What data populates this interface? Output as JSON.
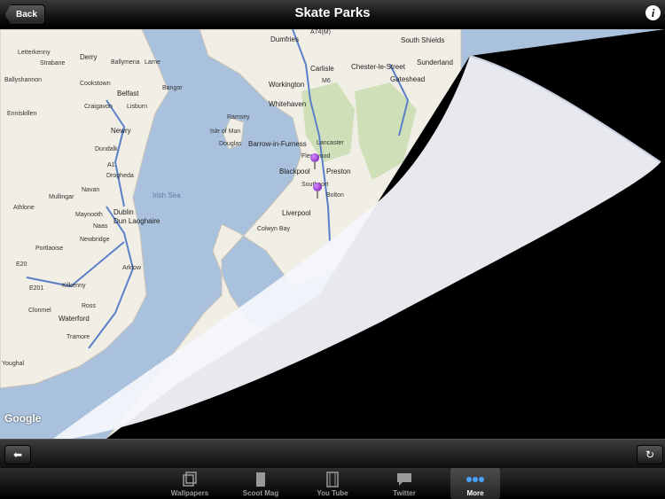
{
  "nav": {
    "title": "Skate Parks",
    "back_label": "Back"
  },
  "map": {
    "logo": "Google",
    "labels": {
      "dumfries": "Dumfries",
      "south_shields": "South Shields",
      "gateshead": "Gateshead",
      "sunderland": "Sunderland",
      "carlisle": "Carlisle",
      "chester": "Chester-le-Street",
      "letterkenny": "Letterkenny",
      "derry": "Derry",
      "strabane": "Strabane",
      "ballymena": "Ballymena",
      "larne": "Larne",
      "belfast": "Belfast",
      "bangor": "Bangor",
      "cookstown": "Cookstown",
      "workington": "Workington",
      "whitehaven": "Whitehaven",
      "ballyshannon": "Ballyshannon",
      "craigavon": "Craigavon",
      "lisburn": "Lisburn",
      "enniskillen": "Enniskillen",
      "ramsey": "Ramsey",
      "isle_of_man": "Isle of Man",
      "douglas": "Douglas",
      "newry": "Newry",
      "barrow": "Barrow-in-Furness",
      "lancaster": "Lancaster",
      "fleetwood": "Fleetwood",
      "blackpool": "Blackpool",
      "preston": "Preston",
      "dundalk": "Dundalk",
      "drogheda": "Drogheda",
      "irish_sea": "Irish Sea",
      "southport": "Southport",
      "bolton": "Bolton",
      "mullingar": "Mullingar",
      "navan": "Navan",
      "athlone": "Athlone",
      "maynooth": "Maynooth",
      "dublin": "Dublin",
      "liverpool": "Liverpool",
      "dun_laoghaire": "Dun Laoghaire",
      "colwyn_bay": "Colwyn Bay",
      "naas": "Naas",
      "newbridge": "Newbridge",
      "portlaoise": "Portlaoise",
      "arklow": "Arklow",
      "kilkenny": "Kilkenny",
      "clonmel": "Clonmel",
      "waterford": "Waterford",
      "ross": "Ross",
      "tramore": "Tramore",
      "youghal": "Youghal",
      "m6": "M6",
      "e20": "E20",
      "e01": "E01",
      "e201": "E201",
      "a1": "A1",
      "m74": "A74(M)"
    }
  },
  "toolbar": {
    "back_arrow": "⬅",
    "refresh": "↻"
  },
  "tabs": [
    {
      "label": "Wallpapers",
      "icon": "wallpapers-icon"
    },
    {
      "label": "Scoot Mag",
      "icon": "book-icon"
    },
    {
      "label": "You Tube",
      "icon": "film-icon"
    },
    {
      "label": "Twitter",
      "icon": "speech-bubble-icon"
    },
    {
      "label": "More",
      "icon": "more-dots-icon"
    }
  ],
  "colors": {
    "sea": "#a9c1dd",
    "land": "#f1eee6",
    "park": "#cfe0b8",
    "pin": "#8a1fd0"
  }
}
